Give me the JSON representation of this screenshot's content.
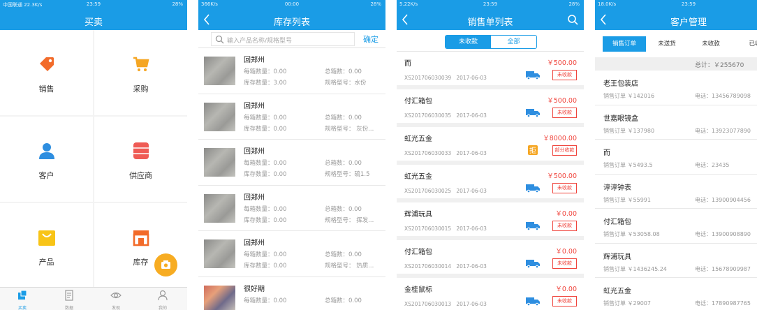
{
  "colors": {
    "accent": "#1a9ce6",
    "price": "#f0453d",
    "fab": "#f7ac22"
  },
  "screen1": {
    "status": {
      "left": "中国联通 22.3K/s",
      "time": "23:59",
      "right": "28%"
    },
    "title": "买卖",
    "grid": [
      {
        "label": "销售",
        "icon": "tag-icon"
      },
      {
        "label": "采购",
        "icon": "cart-icon"
      },
      {
        "label": "客户",
        "icon": "person-icon"
      },
      {
        "label": "供应商",
        "icon": "database-icon"
      },
      {
        "label": "产品",
        "icon": "bag-icon"
      },
      {
        "label": "库存",
        "icon": "store-icon"
      }
    ],
    "tabs": [
      {
        "label": "买卖",
        "icon": "buy-sell-icon"
      },
      {
        "label": "数据",
        "icon": "document-icon"
      },
      {
        "label": "发现",
        "icon": "eye-icon"
      },
      {
        "label": "我的",
        "icon": "profile-icon"
      }
    ]
  },
  "screen2": {
    "status": {
      "left": "366K/s",
      "time": "00:00",
      "right": "28%"
    },
    "title": "库存列表",
    "search_placeholder": "输入产品名称/规格型号",
    "confirm": "确定",
    "items": [
      {
        "name": "回郑州",
        "box_qty": "每箱数量：0.00",
        "total_box": "总箱数：0.00",
        "stock": "库存数量：3.00",
        "spec": "规格型号：水份"
      },
      {
        "name": "回郑州",
        "box_qty": "每箱数量：0.00",
        "total_box": "总箱数：0.00",
        "stock": "库存数量：0.00",
        "spec": "规格型号： 灰份..."
      },
      {
        "name": "回郑州",
        "box_qty": "每箱数量：0.00",
        "total_box": "总箱数：0.00",
        "stock": "库存数量：0.00",
        "spec": "规格型号：硫1.5"
      },
      {
        "name": "回郑州",
        "box_qty": "每箱数量：0.00",
        "total_box": "总箱数：0.00",
        "stock": "库存数量：0.00",
        "spec": "规格型号： 挥发..."
      },
      {
        "name": "回郑州",
        "box_qty": "每箱数量：0.00",
        "total_box": "总箱数：0.00",
        "stock": "库存数量：0.00",
        "spec": "规格型号： 热质..."
      },
      {
        "name": "很好期",
        "box_qty": "每箱数量：0.00",
        "total_box": "总箱数：0.00",
        "stock": "",
        "spec": ""
      }
    ]
  },
  "screen3": {
    "status": {
      "left": "5.22K/s",
      "time": "23:59",
      "right": "28%"
    },
    "title": "销售单列表",
    "seg": [
      "未收款",
      "全部"
    ],
    "orders": [
      {
        "name": "而",
        "amount": "￥500.00",
        "no": "XS201706030039",
        "date": "2017-06-03",
        "status": "未收款",
        "badge": "truck-icon"
      },
      {
        "name": "付汇箱包",
        "amount": "￥500.00",
        "no": "XS201706030035",
        "date": "2017-06-03",
        "status": "未收款",
        "badge": "truck-icon"
      },
      {
        "name": "虹光五金",
        "amount": "￥8000.00",
        "no": "XS201706030033",
        "date": "2017-06-03",
        "status": "部分收款",
        "badge": "reject-badge",
        "badge_text": "拒"
      },
      {
        "name": "虹光五金",
        "amount": "￥500.00",
        "no": "XS201706030025",
        "date": "2017-06-03",
        "status": "未收款",
        "badge": "truck-icon"
      },
      {
        "name": "辉浦玩具",
        "amount": "￥0.00",
        "no": "XS201706030015",
        "date": "2017-06-03",
        "status": "未收款",
        "badge": "truck-icon"
      },
      {
        "name": "付汇箱包",
        "amount": "￥0.00",
        "no": "XS201706030014",
        "date": "2017-06-03",
        "status": "未收款",
        "badge": "truck-icon"
      },
      {
        "name": "金桂鼠标",
        "amount": "￥0.00",
        "no": "XS201706030013",
        "date": "2017-06-03",
        "status": "未收款",
        "badge": "truck-icon"
      }
    ]
  },
  "screen4": {
    "status": {
      "left": "18.0K/s",
      "time": "23:59",
      "right": ""
    },
    "title": "客户管理",
    "tabs": [
      "销售订单",
      "未送货",
      "未收款",
      "已收"
    ],
    "total": "总计：￥255670",
    "customers": [
      {
        "name": "老王包装店",
        "sales": "销售订单 ￥142016",
        "phone": "电话：13456789098"
      },
      {
        "name": "世嘉眼镜盒",
        "sales": "销售订单 ￥137980",
        "phone": "电话：13923077890"
      },
      {
        "name": "而",
        "sales": "销售订单 ￥5493.5",
        "phone": "电话：23435"
      },
      {
        "name": "谆谆钟表",
        "sales": "销售订单 ￥55991",
        "phone": "电话：13900904456"
      },
      {
        "name": "付汇箱包",
        "sales": "销售订单 ￥53058.08",
        "phone": "电话：13900908890"
      },
      {
        "name": "辉浦玩具",
        "sales": "销售订单 ￥1436245.24",
        "phone": "电话：15678909987"
      },
      {
        "name": "虹光五金",
        "sales": "销售订单 ￥29007",
        "phone": "电话：17890987765"
      }
    ]
  }
}
